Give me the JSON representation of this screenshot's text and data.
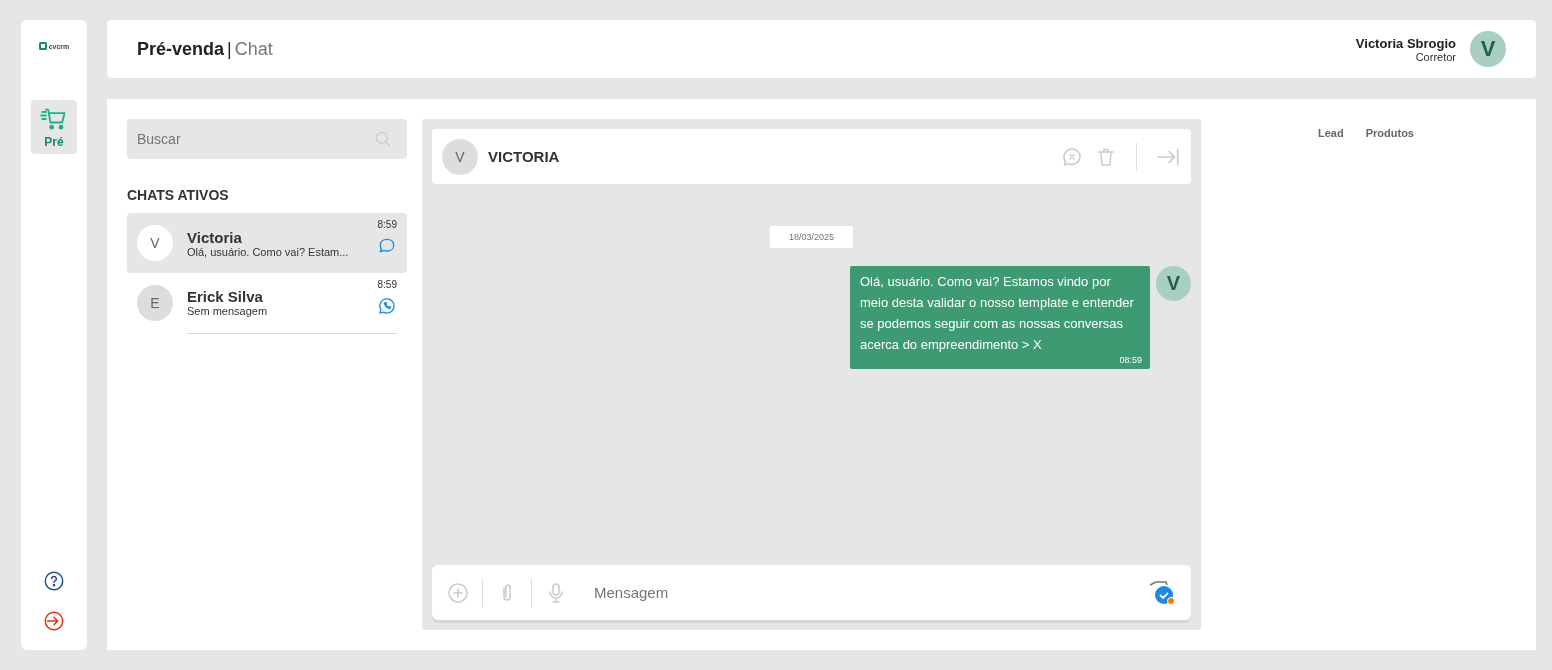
{
  "sidebar": {
    "logo": "cvcrm",
    "items": [
      {
        "label": "Pré",
        "selected": true
      }
    ]
  },
  "header": {
    "title": "Pré-venda",
    "separator": "|",
    "subtitle": "Chat",
    "user": {
      "name": "Victoria Sbrogio",
      "role": "Corretor",
      "initial": "V"
    }
  },
  "search": {
    "placeholder": "Buscar"
  },
  "chats_title": "CHATS ATIVOS",
  "chats": [
    {
      "initial": "V",
      "name": "Victoria",
      "preview": "Olá, usuário. Como vai? Estam...",
      "time": "8:59",
      "kind": "chat",
      "selected": true
    },
    {
      "initial": "E",
      "name": "Erick Silva",
      "preview": "Sem mensagem",
      "time": "8:59",
      "kind": "whatsapp",
      "selected": false
    }
  ],
  "conversation": {
    "initial": "V",
    "name": "VICTORIA",
    "date": "18/03/2025",
    "messages": [
      {
        "text": "Olá, usuário. Como vai? Estamos vindo por meio desta validar o nosso template e entender se podemos seguir com as nossas conversas acerca do empreendimento > X",
        "time": "08:59",
        "initial": "V"
      }
    ],
    "composer": {
      "placeholder": "Mensagem"
    }
  },
  "right_tabs": [
    {
      "label": "Lead",
      "selected": false
    },
    {
      "label": "Produtos",
      "selected": false
    }
  ]
}
